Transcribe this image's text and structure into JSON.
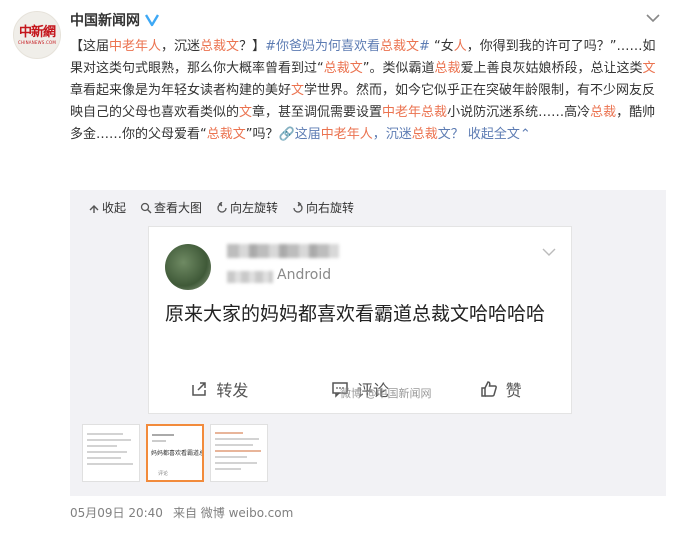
{
  "author": {
    "name": "中国新闻网",
    "logo_cn": "中新網",
    "logo_en": "CHINANEWS.COM"
  },
  "post": {
    "body_segments": [
      {
        "text": "【这届",
        "style": "normal"
      },
      {
        "text": "中老年人",
        "style": "hl"
      },
      {
        "text": "，沉迷",
        "style": "normal"
      },
      {
        "text": "总裁文",
        "style": "hl"
      },
      {
        "text": "？】",
        "style": "normal"
      },
      {
        "text": "#你爸妈为何喜欢看",
        "style": "link"
      },
      {
        "text": "总裁文",
        "style": "hl"
      },
      {
        "text": "#",
        "style": "link"
      },
      {
        "text": " “女",
        "style": "normal"
      },
      {
        "text": "人",
        "style": "hl"
      },
      {
        "text": "，你得到我的许可了吗？”……如果对这类句式眼熟，那么你大概率曾看到过“",
        "style": "normal"
      },
      {
        "text": "总裁文",
        "style": "hl"
      },
      {
        "text": "”。类似霸道",
        "style": "normal"
      },
      {
        "text": "总裁",
        "style": "hl"
      },
      {
        "text": "爱上善良灰姑娘桥段，总让这类",
        "style": "normal"
      },
      {
        "text": "文",
        "style": "hl"
      },
      {
        "text": "章看起来像是为年轻女读者构建的美好",
        "style": "normal"
      },
      {
        "text": "文",
        "style": "hl"
      },
      {
        "text": "学世界。然而，如今它似乎正在突破年龄限制，有不少网友反映自己的父母也喜欢看类似的",
        "style": "normal"
      },
      {
        "text": "文",
        "style": "hl"
      },
      {
        "text": "章，甚至调侃需要设置",
        "style": "normal"
      },
      {
        "text": "中老年总裁",
        "style": "hl"
      },
      {
        "text": "小说防沉迷系统……高冷",
        "style": "normal"
      },
      {
        "text": "总裁",
        "style": "hl"
      },
      {
        "text": "，酷帅多金……你的父母爱看“",
        "style": "normal"
      },
      {
        "text": "总裁文",
        "style": "hl"
      },
      {
        "text": "”吗？",
        "style": "normal"
      },
      {
        "text": "🔗这届",
        "style": "link"
      },
      {
        "text": "中老年人",
        "style": "hl"
      },
      {
        "text": "，沉迷",
        "style": "link"
      },
      {
        "text": "总裁",
        "style": "hl"
      },
      {
        "text": "文？",
        "style": "link"
      },
      {
        "text": " 收起全文",
        "style": "link"
      },
      {
        "text": "⌃",
        "style": "link"
      }
    ]
  },
  "media": {
    "tools": [
      {
        "icon": "collapse-icon",
        "label": "收起"
      },
      {
        "icon": "zoom-icon",
        "label": "查看大图"
      },
      {
        "icon": "rotate-left-icon",
        "label": "向左旋转"
      },
      {
        "icon": "rotate-right-icon",
        "label": "向右旋转"
      }
    ],
    "shot": {
      "device": "Android",
      "text": "原来大家的妈妈都喜欢看霸道总裁文哈哈哈哈",
      "actions": [
        {
          "icon": "share-icon",
          "label": "转发"
        },
        {
          "icon": "comment-icon",
          "label": "评论"
        },
        {
          "icon": "like-icon",
          "label": "赞"
        }
      ],
      "watermark": "微博 @中国新闻网"
    },
    "thumb_text": "妈妈都喜欢看霸道总",
    "thumb_comment": "评论"
  },
  "meta": {
    "date": "05月09日 20:40",
    "source": "来自 微博 weibo.com"
  },
  "colors": {
    "highlight": "#eb7350",
    "link": "#5d7cb3",
    "verified": "#3da8f5",
    "thumb_active": "#f28b3c"
  }
}
